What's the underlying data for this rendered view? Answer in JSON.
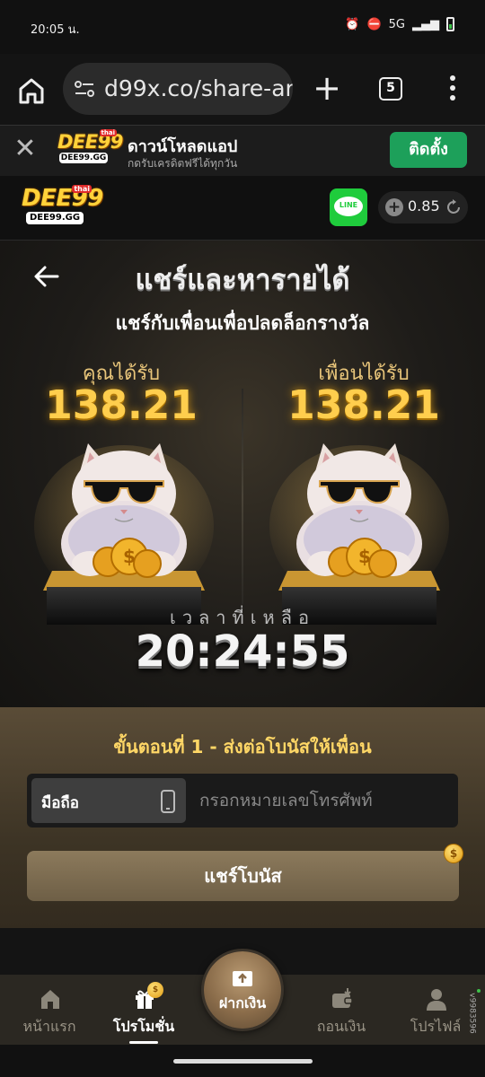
{
  "status_bar": {
    "time": "20:05 น.",
    "network": "5G"
  },
  "browser": {
    "url": "d99x.co/share-ar",
    "tab_count": "5"
  },
  "download_banner": {
    "title": "ดาวน์โหลดแอป",
    "subtitle": "กดรับเครดิตฟรีได้ทุกวัน",
    "install_label": "ติดตั้ง"
  },
  "logo": {
    "brand": "DEE99",
    "domain": "DEE99.GG",
    "tag": "thai"
  },
  "header": {
    "line_label": "LINE",
    "balance": "0.85"
  },
  "hero": {
    "title": "แชร์และหารายได้",
    "subtitle": "แชร์กับเพื่อนเพื่อปลดล็อกรางวัล",
    "you_receive_label": "คุณได้รับ",
    "you_receive_amount": "138.21",
    "friend_receive_label": "เพื่อนได้รับ",
    "friend_receive_amount": "138.21",
    "time_left_label": "เวลาที่เหลือ",
    "countdown": "20:24:55"
  },
  "step": {
    "title": "ขั้นตอนที่ 1 - ส่งต่อโบนัสให้เพื่อน",
    "phone_type_label": "มือถือ",
    "phone_placeholder": "กรอกหมายเลขโทรศัพท์",
    "share_button": "แชร์โบนัส"
  },
  "bottom_nav": {
    "home": "หน้าแรก",
    "promotions": "โปรโมชั่น",
    "deposit": "ฝากเงิน",
    "withdraw": "ถอนเงิน",
    "profile": "โปรไฟล์"
  },
  "version_text": "v9983596"
}
